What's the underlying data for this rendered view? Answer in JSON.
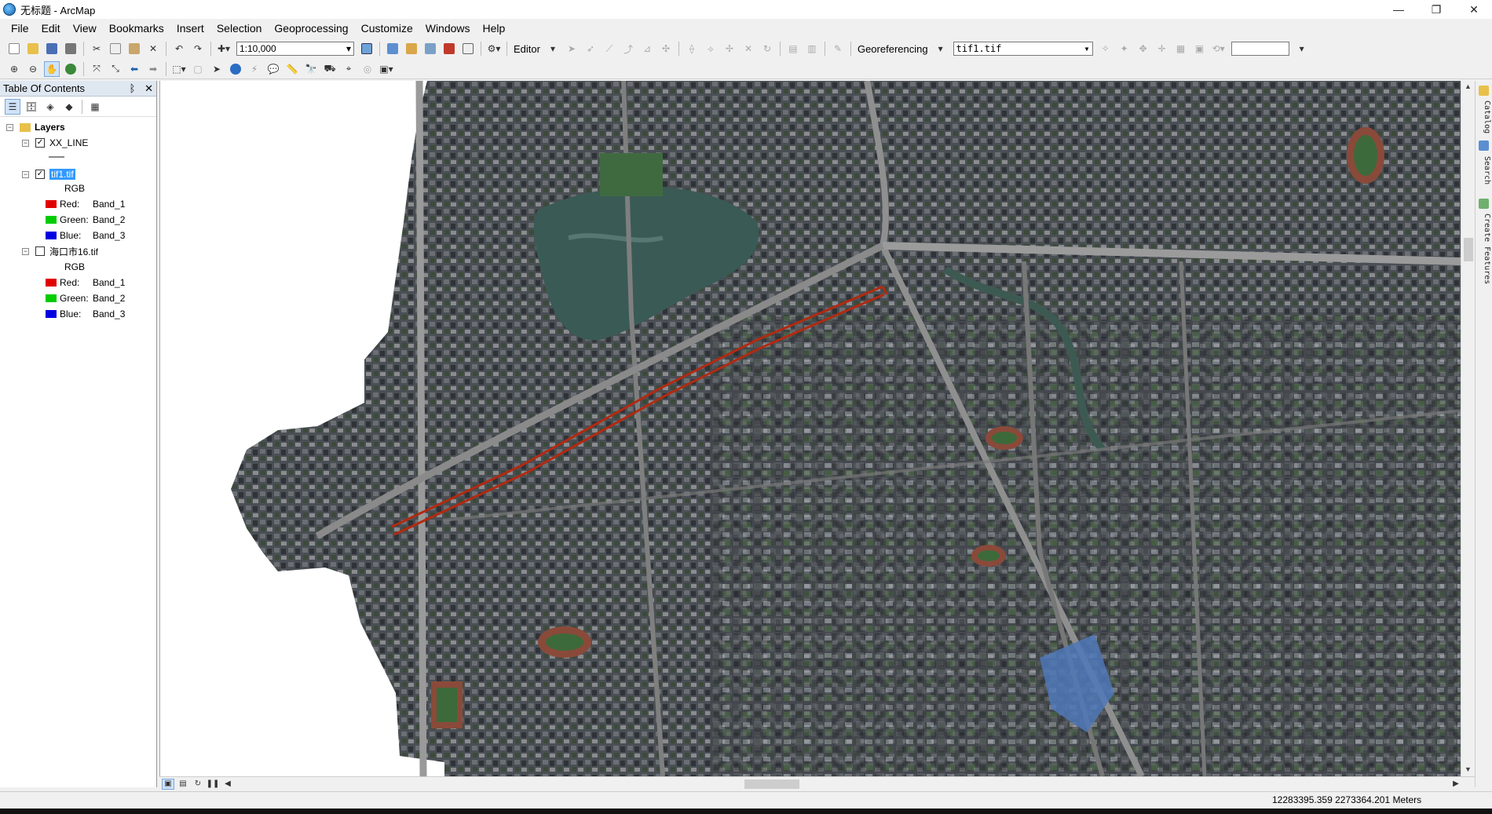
{
  "window": {
    "title": "无标题 - ArcMap",
    "minimize": "—",
    "maximize": "❐",
    "close": "✕"
  },
  "menu": [
    "File",
    "Edit",
    "View",
    "Bookmarks",
    "Insert",
    "Selection",
    "Geoprocessing",
    "Customize",
    "Windows",
    "Help"
  ],
  "toolbar": {
    "scale": "1:10,000",
    "editor_label": "Editor",
    "georef_label": "Georeferencing",
    "georef_layer": "tif1.tif"
  },
  "toc": {
    "title": "Table Of Contents",
    "pin": "ᛒ",
    "close": "✕",
    "root": "Layers",
    "layers": [
      {
        "name": "XX_LINE",
        "checked": true,
        "symbol": "line"
      },
      {
        "name": "tif1.tif",
        "checked": true,
        "selected": true,
        "rgb": "RGB",
        "bands": [
          {
            "label": "Red:",
            "band": "Band_1",
            "color": "#e00000"
          },
          {
            "label": "Green:",
            "band": "Band_2",
            "color": "#00cc00"
          },
          {
            "label": "Blue:",
            "band": "Band_3",
            "color": "#0000e0"
          }
        ]
      },
      {
        "name": "海口市16.tif",
        "checked": false,
        "rgb": "RGB",
        "bands": [
          {
            "label": "Red:",
            "band": "Band_1",
            "color": "#e00000"
          },
          {
            "label": "Green:",
            "band": "Band_2",
            "color": "#00cc00"
          },
          {
            "label": "Blue:",
            "band": "Band_3",
            "color": "#0000e0"
          }
        ]
      }
    ]
  },
  "side_tabs": [
    "Catalog",
    "Search",
    "Create Features"
  ],
  "status": {
    "coords": "12283395.359  2273364.201 Meters"
  },
  "colors": {
    "selection": "#3399ff",
    "route_line": "#b22a10",
    "lake": "#3a5a55"
  }
}
